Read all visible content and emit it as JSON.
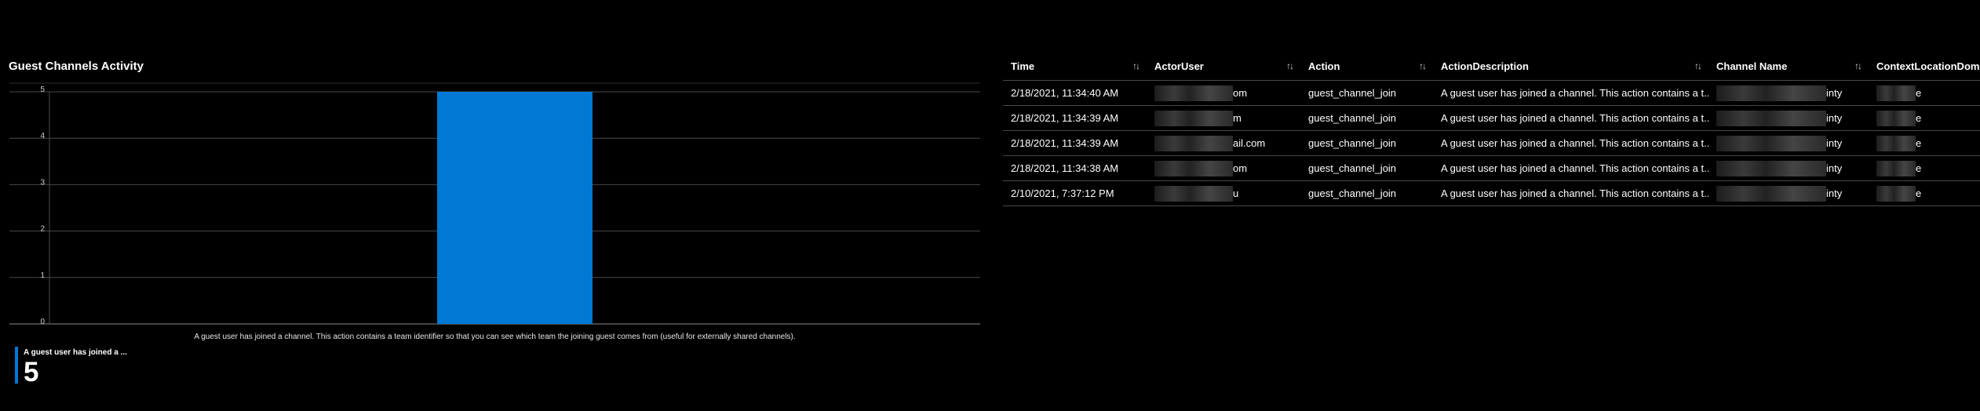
{
  "chart": {
    "title": "Guest Channels Activity",
    "caption": "A guest user has joined a channel. This action contains a team identifier so that you can see which team the joining guest comes from (useful for externally shared channels)."
  },
  "chart_data": {
    "type": "bar",
    "title": "Guest Channels Activity",
    "categories": [
      "A guest user has joined a channel. This action contains a team identifier so that you can see which team the joining guest comes from (useful for externally shared channels)."
    ],
    "values": [
      5
    ],
    "ylim": [
      0,
      5
    ],
    "yticks": [
      "0",
      "1",
      "2",
      "3",
      "4",
      "5"
    ],
    "grid": true,
    "bar_color": "#0078d4"
  },
  "kpi": {
    "label": "A guest user has joined a ...",
    "value": "5",
    "accent": "#0078d4"
  },
  "table": {
    "columns": [
      "Time",
      "ActorUser",
      "Action",
      "ActionDescription",
      "Channel Name",
      "ContextLocationDoma"
    ],
    "sort_icon": "sort-arrows-icon",
    "rows": [
      {
        "time": "2/18/2021, 11:34:40 AM",
        "actor_suffix": "om",
        "action": "guest_channel_join",
        "description": "A guest user has joined a channel. This action contains a t...",
        "channel_suffix": "inty",
        "context_suffix": "e"
      },
      {
        "time": "2/18/2021, 11:34:39 AM",
        "actor_suffix": "m",
        "action": "guest_channel_join",
        "description": "A guest user has joined a channel. This action contains a t...",
        "channel_suffix": "inty",
        "context_suffix": "e"
      },
      {
        "time": "2/18/2021, 11:34:39 AM",
        "actor_suffix": "ail.com",
        "action": "guest_channel_join",
        "description": "A guest user has joined a channel. This action contains a t...",
        "channel_suffix": "inty",
        "context_suffix": "e"
      },
      {
        "time": "2/18/2021, 11:34:38 AM",
        "actor_suffix": "om",
        "action": "guest_channel_join",
        "description": "A guest user has joined a channel. This action contains a t...",
        "channel_suffix": "inty",
        "context_suffix": "e"
      },
      {
        "time": "2/10/2021, 7:37:12 PM",
        "actor_suffix": "u",
        "action": "guest_channel_join",
        "description": "A guest user has joined a channel. This action contains a t...",
        "channel_suffix": "inty",
        "context_suffix": "e"
      }
    ]
  }
}
